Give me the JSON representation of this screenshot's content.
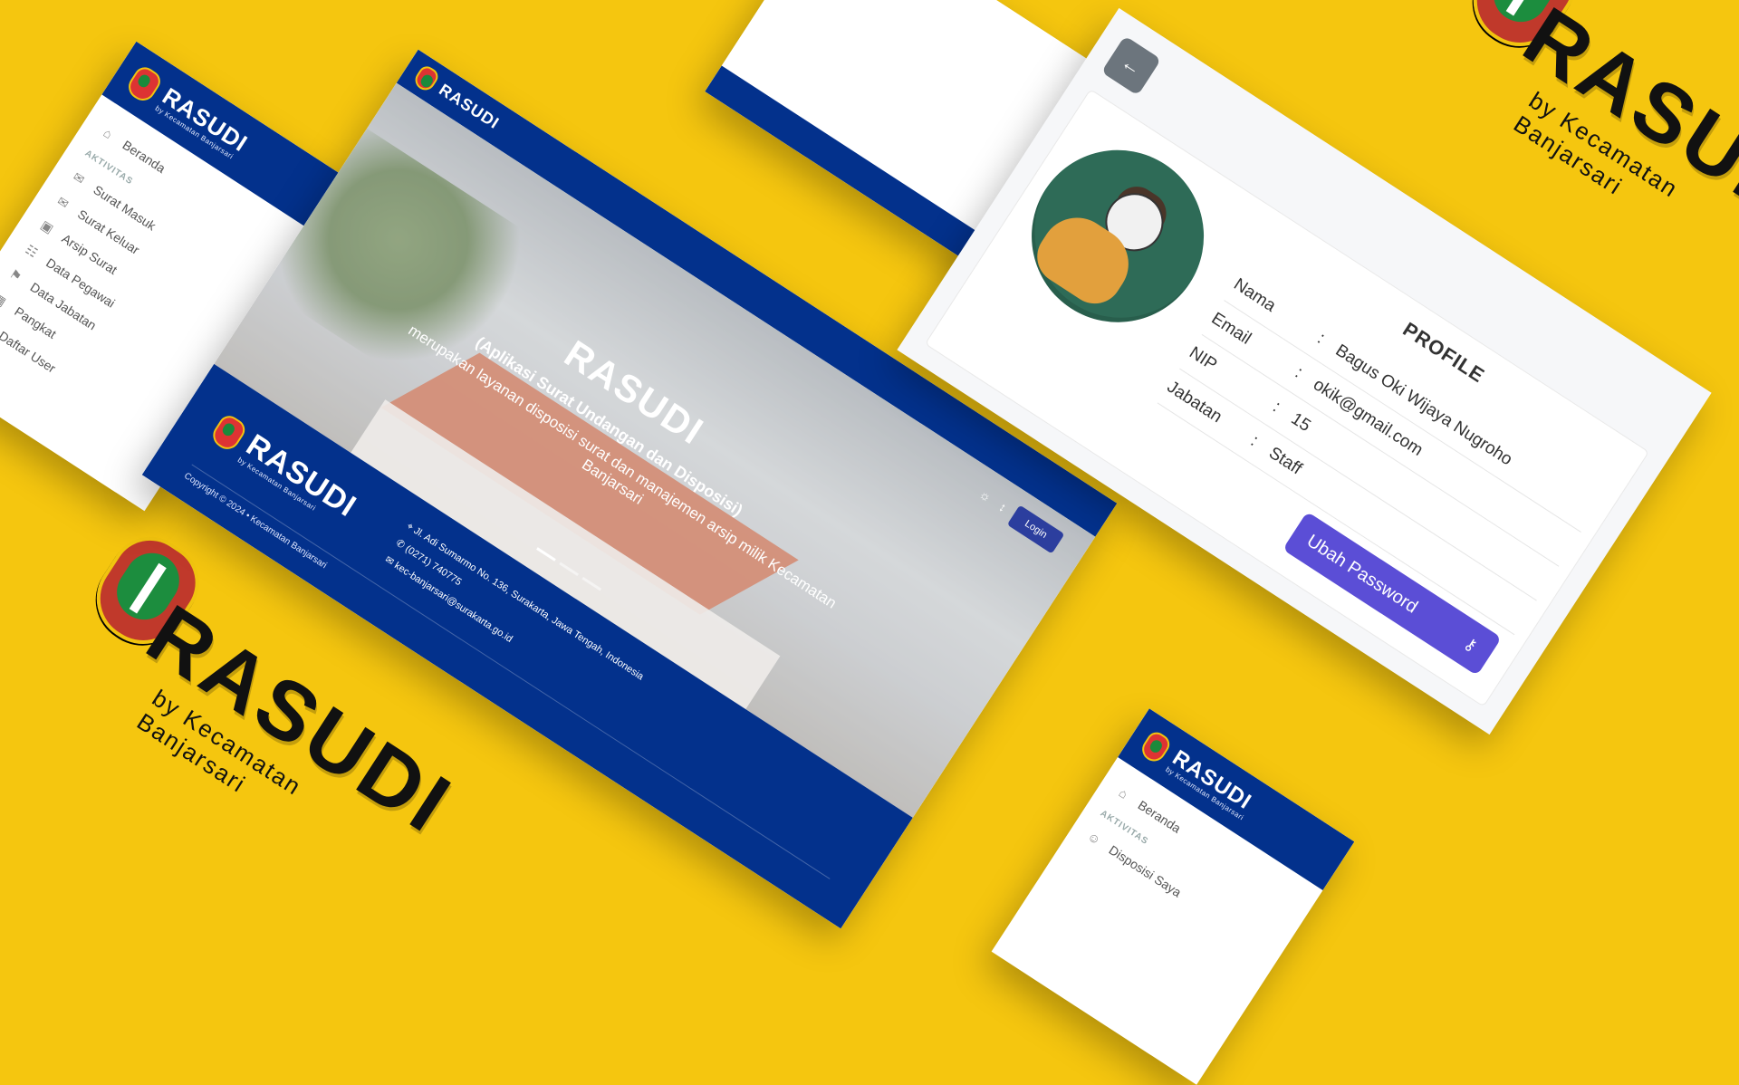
{
  "brand": {
    "name": "RASUDI",
    "tagline": "by Kecamatan Banjarsari"
  },
  "sidebar_admin": {
    "home": "Beranda",
    "section": "AKTIVITAS",
    "items": [
      {
        "label": "Surat Masuk",
        "icon": "mail-in-icon"
      },
      {
        "label": "Surat Keluar",
        "icon": "mail-out-icon"
      },
      {
        "label": "Arsip Surat",
        "icon": "archive-icon"
      },
      {
        "label": "Data Pegawai",
        "icon": "users-icon"
      },
      {
        "label": "Data Jabatan",
        "icon": "position-icon"
      },
      {
        "label": "Pangkat",
        "icon": "rank-icon"
      },
      {
        "label": "Daftar User",
        "icon": "user-list-icon"
      }
    ]
  },
  "sidebar_user": {
    "home": "Beranda",
    "section": "AKTIVITAS",
    "items": [
      {
        "label": "Disposisi Saya",
        "icon": "user-icon"
      }
    ]
  },
  "landing": {
    "hero_title": "RASUDI",
    "hero_subtitle": "(Aplikasi Surat Undangan dan Disposisi)",
    "hero_desc": "merupakan layanan disposisi surat dan manajemen arsip milik Kecamatan Banjarsari",
    "login_label": "Login",
    "footer": {
      "address": "Jl. Adi Sumarmo No. 136, Surakarta, Jawa Tengah, Indonesia",
      "phone": "(0271) 740775",
      "email": "kec-banjarsari@surakarta.go.id",
      "copyright": "Copyright © 2024 • Kecamatan Banjarsari"
    }
  },
  "profile": {
    "title": "PROFILE",
    "rows": [
      {
        "label": "Nama",
        "value": "Bagus Oki Wijaya Nugroho"
      },
      {
        "label": "Email",
        "value": "okik@gmail.com"
      },
      {
        "label": "NIP",
        "value": "15"
      },
      {
        "label": "Jabatan",
        "value": "Staff"
      }
    ],
    "sep": ":",
    "change_password_label": "Ubah Password",
    "back_icon": "←"
  },
  "colors": {
    "background": "#f5c60f",
    "navy": "#03318c",
    "button_purple": "#5b4ed6"
  }
}
